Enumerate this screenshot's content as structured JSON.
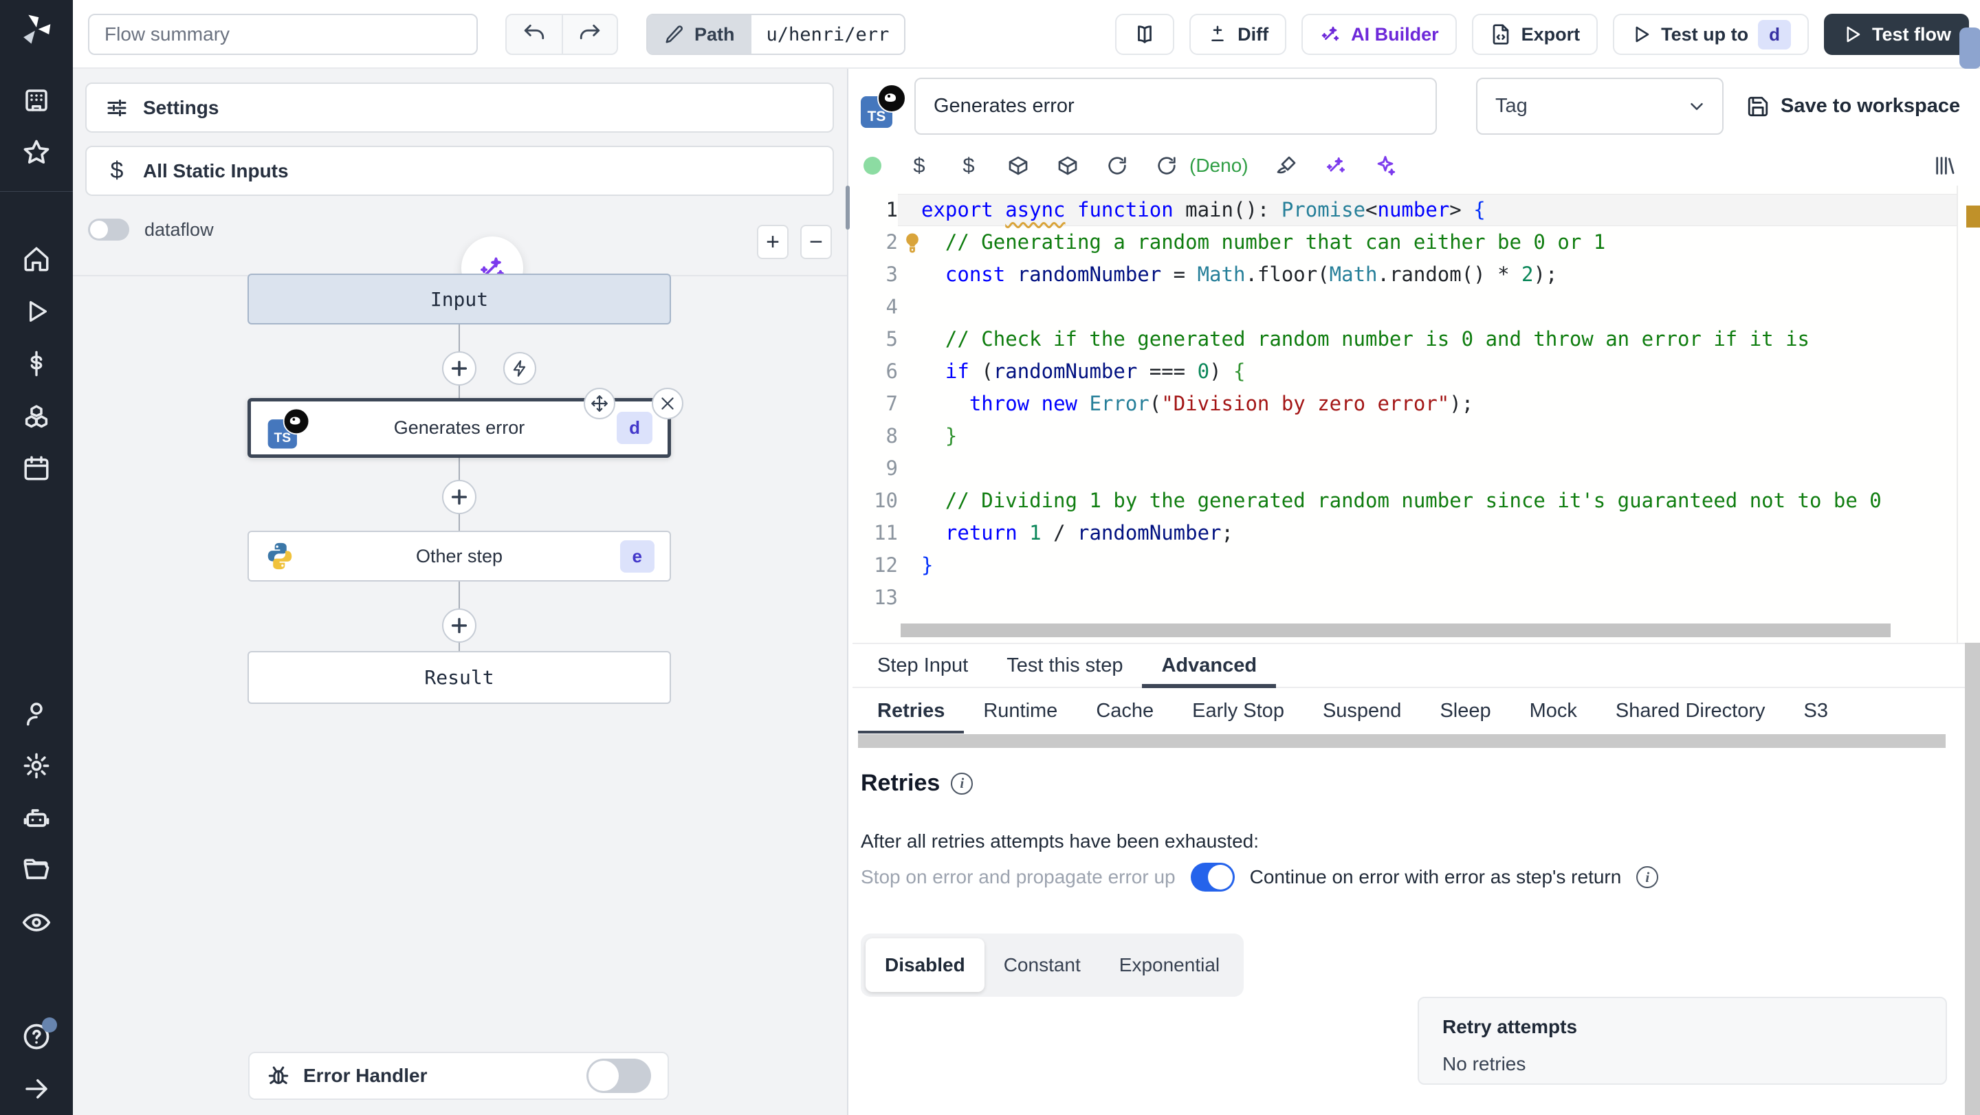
{
  "topbar": {
    "flow_summary_placeholder": "Flow summary",
    "path_label": "Path",
    "path_value": "u/henri/err",
    "diff_label": "Diff",
    "ai_builder_label": "AI Builder",
    "export_label": "Export",
    "test_up_to_label": "Test up to",
    "test_up_to_badge": "d",
    "test_flow_label": "Test flow"
  },
  "left_panel": {
    "settings_label": "Settings",
    "static_inputs_label": "All Static Inputs",
    "dataflow_label": "dataflow",
    "error_handler_label": "Error Handler",
    "graph": {
      "input_label": "Input",
      "steps": [
        {
          "title": "Generates error",
          "badge": "d",
          "lang": "typescript-deno"
        },
        {
          "title": "Other step",
          "badge": "e",
          "lang": "python"
        }
      ],
      "result_label": "Result"
    }
  },
  "step_editor": {
    "title_value": "Generates error",
    "tag_label": "Tag",
    "save_label": "Save to workspace",
    "runtime_label": "(Deno)",
    "code": {
      "language": "typescript",
      "line_count": 13,
      "lines": [
        [
          [
            "kw",
            "export "
          ],
          [
            "kw sq",
            "async"
          ],
          [
            "kw",
            " function "
          ],
          [
            "fn",
            "main"
          ],
          [
            "pun",
            "(): "
          ],
          [
            "type",
            "Promise"
          ],
          [
            "pun",
            "<"
          ],
          [
            "kw",
            "number"
          ],
          [
            "pun",
            "> "
          ],
          [
            "bb",
            "{"
          ]
        ],
        [
          [
            "pln",
            "  "
          ],
          [
            "cmt",
            "// Generating a random number that can either be 0 or 1"
          ]
        ],
        [
          [
            "pln",
            "  "
          ],
          [
            "kw",
            "const "
          ],
          [
            "vr",
            "randomNumber "
          ],
          [
            "pun",
            "= "
          ],
          [
            "type",
            "Math"
          ],
          [
            "pln",
            ".floor("
          ],
          [
            "type",
            "Math"
          ],
          [
            "pln",
            ".random() "
          ],
          [
            "pun",
            "* "
          ],
          [
            "num",
            "2"
          ],
          [
            "pln",
            ");"
          ]
        ],
        [],
        [
          [
            "pln",
            "  "
          ],
          [
            "cmt",
            "// Check if the generated random number is 0 and throw an error if it is"
          ]
        ],
        [
          [
            "pln",
            "  "
          ],
          [
            "kw",
            "if "
          ],
          [
            "pln",
            "("
          ],
          [
            "vr",
            "randomNumber "
          ],
          [
            "pun",
            "=== "
          ],
          [
            "num",
            "0"
          ],
          [
            "pln",
            ") "
          ],
          [
            "bg",
            "{"
          ]
        ],
        [
          [
            "pln",
            "    "
          ],
          [
            "kw",
            "throw "
          ],
          [
            "kw",
            "new "
          ],
          [
            "type",
            "Error"
          ],
          [
            "pln",
            "("
          ],
          [
            "str",
            "\"Division by zero error\""
          ],
          [
            "pln",
            ");"
          ]
        ],
        [
          [
            "pln",
            "  "
          ],
          [
            "bg",
            "}"
          ]
        ],
        [],
        [
          [
            "pln",
            "  "
          ],
          [
            "cmt",
            "// Dividing 1 by the generated random number since it's guaranteed not to be 0"
          ]
        ],
        [
          [
            "pln",
            "  "
          ],
          [
            "kw",
            "return "
          ],
          [
            "num",
            "1 "
          ],
          [
            "pun",
            "/ "
          ],
          [
            "vr",
            "randomNumber"
          ],
          [
            "pln",
            ";"
          ]
        ],
        [
          [
            "bb",
            "}"
          ]
        ],
        []
      ]
    }
  },
  "tabs": [
    "Step Input",
    "Test this step",
    "Advanced"
  ],
  "active_tab": "Advanced",
  "subtabs": [
    "Retries",
    "Runtime",
    "Cache",
    "Early Stop",
    "Suspend",
    "Sleep",
    "Mock",
    "Shared Directory",
    "S3"
  ],
  "active_subtab": "Retries",
  "retries": {
    "heading": "Retries",
    "exhausted_text": "After all retries attempts have been exhausted:",
    "stop_label": "Stop on error and propagate error up",
    "continue_label": "Continue on error with error as step's return",
    "toggle_state": "on",
    "modes": [
      "Disabled",
      "Constant",
      "Exponential"
    ],
    "active_mode": "Disabled",
    "retry_attempts_label": "Retry attempts",
    "retry_attempts_value": "No retries"
  },
  "colors": {
    "accent_blue": "#2563eb",
    "ai_purple": "#6d28d9",
    "deno_green": "#2f9e44",
    "badge_bg": "#dce2fb",
    "badge_text": "#3730a3",
    "sidebar_bg": "#1e242e",
    "dark_button": "#2e3945",
    "ruler_marker": "#c09129"
  }
}
